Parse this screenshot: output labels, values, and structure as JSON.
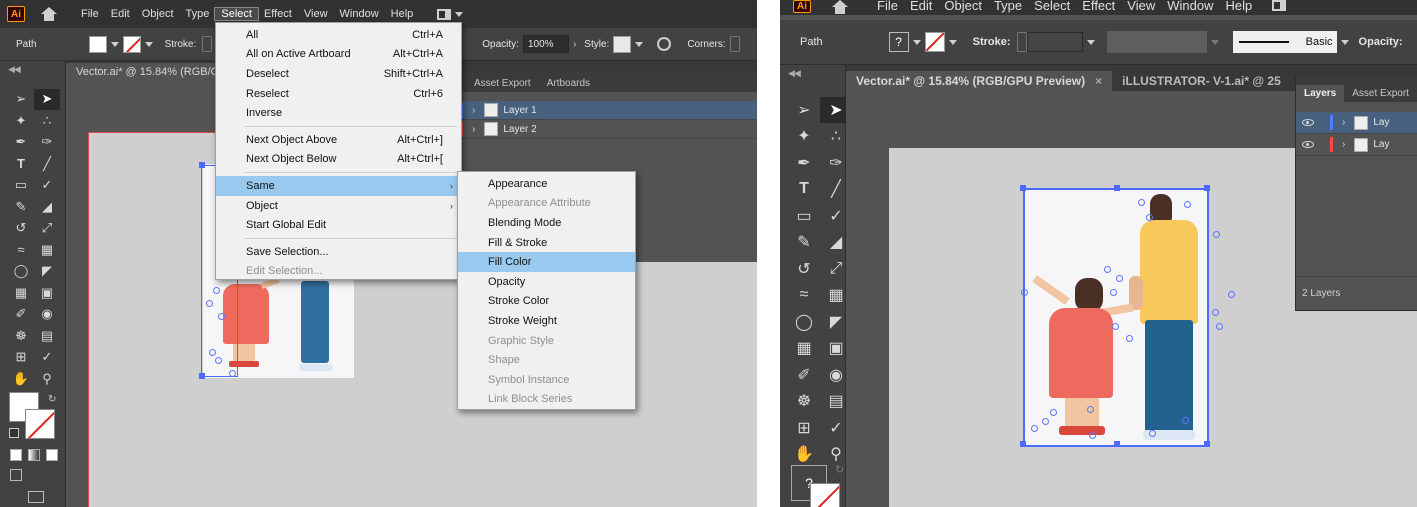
{
  "left": {
    "app_logo": "Ai",
    "menus": [
      "File",
      "Edit",
      "Object",
      "Type",
      "Select",
      "Effect",
      "View",
      "Window",
      "Help"
    ],
    "control": {
      "path_label": "Path",
      "stroke_label": "Stroke:",
      "opacity_label": "Opacity:",
      "opacity_value": "100%",
      "style_label": "Style:",
      "corners_label": "Corners:"
    },
    "doc_tab": "Vector.ai* @ 15.84% (RGB/GPU",
    "panel_tabs": [
      "Asset Export",
      "Artboards"
    ],
    "layers": [
      {
        "name": "Layer 1",
        "color": "#4f7fff"
      },
      {
        "name": "Layer 2",
        "color": "#ff4848"
      }
    ],
    "select_menu": {
      "items": [
        {
          "label": "All",
          "shortcut": "Ctrl+A"
        },
        {
          "label": "All on Active Artboard",
          "shortcut": "Alt+Ctrl+A"
        },
        {
          "label": "Deselect",
          "shortcut": "Shift+Ctrl+A"
        },
        {
          "label": "Reselect",
          "shortcut": "Ctrl+6"
        },
        {
          "label": "Inverse",
          "shortcut": ""
        },
        {
          "label": "Next Object Above",
          "shortcut": "Alt+Ctrl+]"
        },
        {
          "label": "Next Object Below",
          "shortcut": "Alt+Ctrl+["
        },
        {
          "label": "Same",
          "shortcut": ""
        },
        {
          "label": "Object",
          "shortcut": ""
        },
        {
          "label": "Start Global Edit",
          "shortcut": ""
        },
        {
          "label": "Save Selection...",
          "shortcut": ""
        },
        {
          "label": "Edit Selection...",
          "shortcut": ""
        }
      ]
    },
    "same_submenu": {
      "items": [
        "Appearance",
        "Appearance Attribute",
        "Blending Mode",
        "Fill & Stroke",
        "Fill Color",
        "Opacity",
        "Stroke Color",
        "Stroke Weight",
        "Graphic Style",
        "Shape",
        "Symbol Instance",
        "Link Block Series"
      ]
    }
  },
  "right": {
    "app_logo": "Ai",
    "menus": [
      "File",
      "Edit",
      "Object",
      "Type",
      "Select",
      "Effect",
      "View",
      "Window",
      "Help"
    ],
    "control": {
      "path_label": "Path",
      "fill_unknown": "?",
      "stroke_label": "Stroke:",
      "brush_label": "Basic",
      "opacity_label": "Opacity:"
    },
    "doc_tabs": [
      "Vector.ai* @ 15.84% (RGB/GPU Preview)",
      "iLLUSTRATOR- V-1.ai* @ 25"
    ],
    "panel_tabs": [
      "Layers",
      "Asset Export"
    ],
    "layers_partial": [
      "Lay",
      "Lay"
    ],
    "layers_count": "2 Layers",
    "fill_unknown": "?"
  }
}
